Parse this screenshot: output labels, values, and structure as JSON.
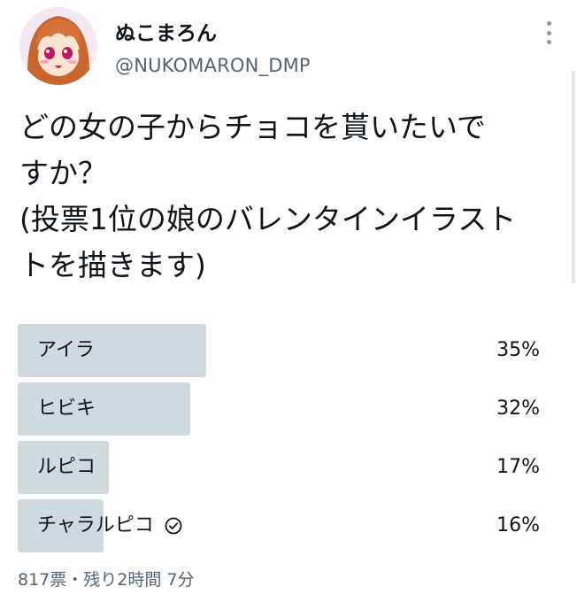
{
  "author": {
    "display_name": "ぬこまろん",
    "handle": "@NUKOMARON_DMP",
    "avatar_icon": "anime-girl-avatar"
  },
  "menu": {
    "more_icon": "vertical-ellipsis-icon"
  },
  "tweet": {
    "lines": [
      "どの女の子からチョコを貰いたいで",
      "すか？",
      "(投票1位の娘のバレンタインイラスト",
      "トを描きます)"
    ]
  },
  "poll": {
    "options": [
      {
        "label": "アイラ",
        "percent_text": "35%",
        "percent": 35,
        "winner": false
      },
      {
        "label": "ヒビキ",
        "percent_text": "32%",
        "percent": 32,
        "winner": false
      },
      {
        "label": "ルピコ",
        "percent_text": "17%",
        "percent": 17,
        "winner": false
      },
      {
        "label": "チャラルピコ",
        "percent_text": "16%",
        "percent": 16,
        "winner": true
      }
    ],
    "meta": "817票・残り2時間 7分"
  },
  "colors": {
    "bar": "#cfd9de",
    "secondary_text": "#536471",
    "primary_text": "#0f1419"
  }
}
